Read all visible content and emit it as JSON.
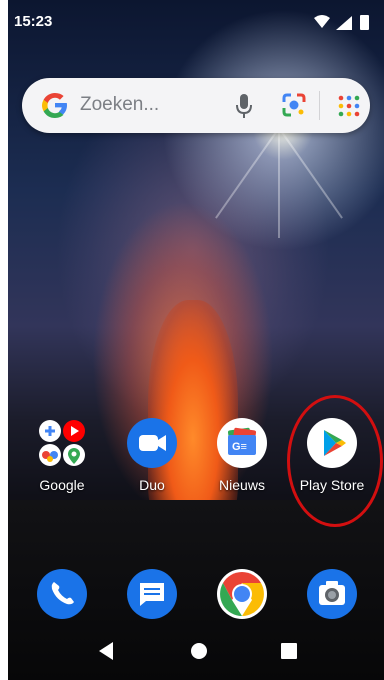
{
  "status_bar": {
    "time": "15:23"
  },
  "search_bar": {
    "placeholder": "Zoeken..."
  },
  "apps": [
    {
      "label": "Google"
    },
    {
      "label": "Duo"
    },
    {
      "label": "Nieuws"
    },
    {
      "label": "Play Store"
    }
  ],
  "dock": [
    "phone-icon",
    "messages-icon",
    "chrome-icon",
    "camera-icon"
  ],
  "nav": [
    "back-icon",
    "home-icon",
    "recents-icon"
  ],
  "colors": {
    "highlight": "#d20f10",
    "google_blue": "#4285f4",
    "google_red": "#ea4335",
    "google_yellow": "#fbbc05",
    "google_green": "#34a853"
  }
}
